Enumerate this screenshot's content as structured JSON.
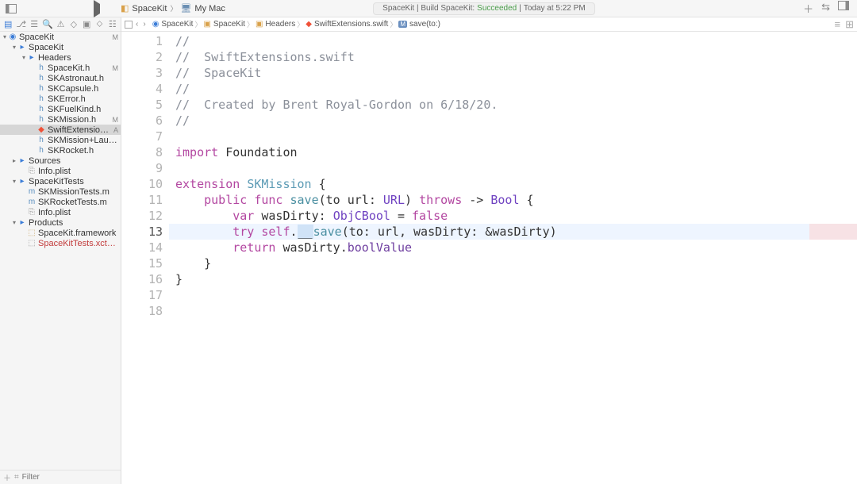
{
  "titlebar": {
    "scheme_project": "SpaceKit",
    "scheme_device": "My Mac",
    "status_prefix": "SpaceKit | Build SpaceKit:",
    "status_result": "Succeeded",
    "status_time": "Today at 5:22 PM"
  },
  "navigator": {
    "filter_placeholder": "Filter"
  },
  "tree": [
    {
      "depth": 0,
      "kind": "proj",
      "label": "SpaceKit",
      "badge": "M",
      "disc": "▾"
    },
    {
      "depth": 1,
      "kind": "folder",
      "label": "SpaceKit",
      "disc": "▾"
    },
    {
      "depth": 2,
      "kind": "folder",
      "label": "Headers",
      "disc": "▾"
    },
    {
      "depth": 3,
      "kind": "header",
      "label": "SpaceKit.h",
      "badge": "M"
    },
    {
      "depth": 3,
      "kind": "header",
      "label": "SKAstronaut.h"
    },
    {
      "depth": 3,
      "kind": "header",
      "label": "SKCapsule.h"
    },
    {
      "depth": 3,
      "kind": "header",
      "label": "SKError.h"
    },
    {
      "depth": 3,
      "kind": "header",
      "label": "SKFuelKind.h"
    },
    {
      "depth": 3,
      "kind": "header",
      "label": "SKMission.h",
      "badge": "M"
    },
    {
      "depth": 3,
      "kind": "swift",
      "label": "SwiftExtensions.swift",
      "badge": "A",
      "selected": true
    },
    {
      "depth": 3,
      "kind": "header",
      "label": "SKMission+Launch.h"
    },
    {
      "depth": 3,
      "kind": "header",
      "label": "SKRocket.h"
    },
    {
      "depth": 1,
      "kind": "folder",
      "label": "Sources",
      "disc": "▸"
    },
    {
      "depth": 2,
      "kind": "plist",
      "label": "Info.plist"
    },
    {
      "depth": 1,
      "kind": "folder",
      "label": "SpaceKitTests",
      "disc": "▾"
    },
    {
      "depth": 2,
      "kind": "src",
      "label": "SKMissionTests.m"
    },
    {
      "depth": 2,
      "kind": "src",
      "label": "SKRocketTests.m"
    },
    {
      "depth": 2,
      "kind": "plist",
      "label": "Info.plist"
    },
    {
      "depth": 1,
      "kind": "folder",
      "label": "Products",
      "disc": "▾"
    },
    {
      "depth": 2,
      "kind": "lego",
      "label": "SpaceKit.framework"
    },
    {
      "depth": 2,
      "kind": "gray",
      "label": "SpaceKitTests.xctest",
      "red": true
    }
  ],
  "jumpbar": [
    {
      "icon": "proj",
      "label": "SpaceKit"
    },
    {
      "icon": "folder",
      "label": "SpaceKit"
    },
    {
      "icon": "folder",
      "label": "Headers"
    },
    {
      "icon": "swift",
      "label": "SwiftExtensions.swift"
    },
    {
      "icon": "method",
      "label": "save(to:)"
    }
  ],
  "code": {
    "active_line": 13,
    "lines": [
      [
        {
          "c": "tok-comment",
          "t": "//"
        }
      ],
      [
        {
          "c": "tok-comment",
          "t": "//  SwiftExtensions.swift"
        }
      ],
      [
        {
          "c": "tok-comment",
          "t": "//  SpaceKit"
        }
      ],
      [
        {
          "c": "tok-comment",
          "t": "//"
        }
      ],
      [
        {
          "c": "tok-comment",
          "t": "//  Created by Brent Royal-Gordon on 6/18/20."
        }
      ],
      [
        {
          "c": "tok-comment",
          "t": "//"
        }
      ],
      [],
      [
        {
          "c": "tok-keyword",
          "t": "import"
        },
        {
          "t": " "
        },
        {
          "c": "tok-var",
          "t": "Foundation"
        }
      ],
      [],
      [
        {
          "c": "tok-keyword",
          "t": "extension"
        },
        {
          "t": " "
        },
        {
          "c": "tok-type",
          "t": "SKMission"
        },
        {
          "t": " {"
        }
      ],
      [
        {
          "t": "    "
        },
        {
          "c": "tok-keyword",
          "t": "public"
        },
        {
          "t": " "
        },
        {
          "c": "tok-keyword",
          "t": "func"
        },
        {
          "t": " "
        },
        {
          "c": "tok-func",
          "t": "save"
        },
        {
          "t": "(to url: "
        },
        {
          "c": "tok-typekey",
          "t": "URL"
        },
        {
          "t": ") "
        },
        {
          "c": "tok-keyword",
          "t": "throws"
        },
        {
          "t": " -> "
        },
        {
          "c": "tok-typekey",
          "t": "Bool"
        },
        {
          "t": " {"
        }
      ],
      [
        {
          "t": "        "
        },
        {
          "c": "tok-keyword",
          "t": "var"
        },
        {
          "t": " wasDirty: "
        },
        {
          "c": "tok-typekey",
          "t": "ObjCBool"
        },
        {
          "t": " = "
        },
        {
          "c": "tok-keyword",
          "t": "false"
        }
      ],
      [
        {
          "t": "        "
        },
        {
          "c": "tok-keyword",
          "t": "try"
        },
        {
          "t": " "
        },
        {
          "c": "tok-self",
          "t": "self"
        },
        {
          "t": "."
        },
        {
          "c": "tok-cursor",
          "t": "__"
        },
        {
          "c": "tok-func",
          "t": "save"
        },
        {
          "t": "(to: url, wasDirty: &wasDirty)"
        }
      ],
      [
        {
          "t": "        "
        },
        {
          "c": "tok-keyword",
          "t": "return"
        },
        {
          "t": " wasDirty."
        },
        {
          "c": "tok-prop",
          "t": "boolValue"
        }
      ],
      [
        {
          "t": "    }"
        }
      ],
      [
        {
          "t": "}"
        }
      ],
      [],
      []
    ]
  }
}
